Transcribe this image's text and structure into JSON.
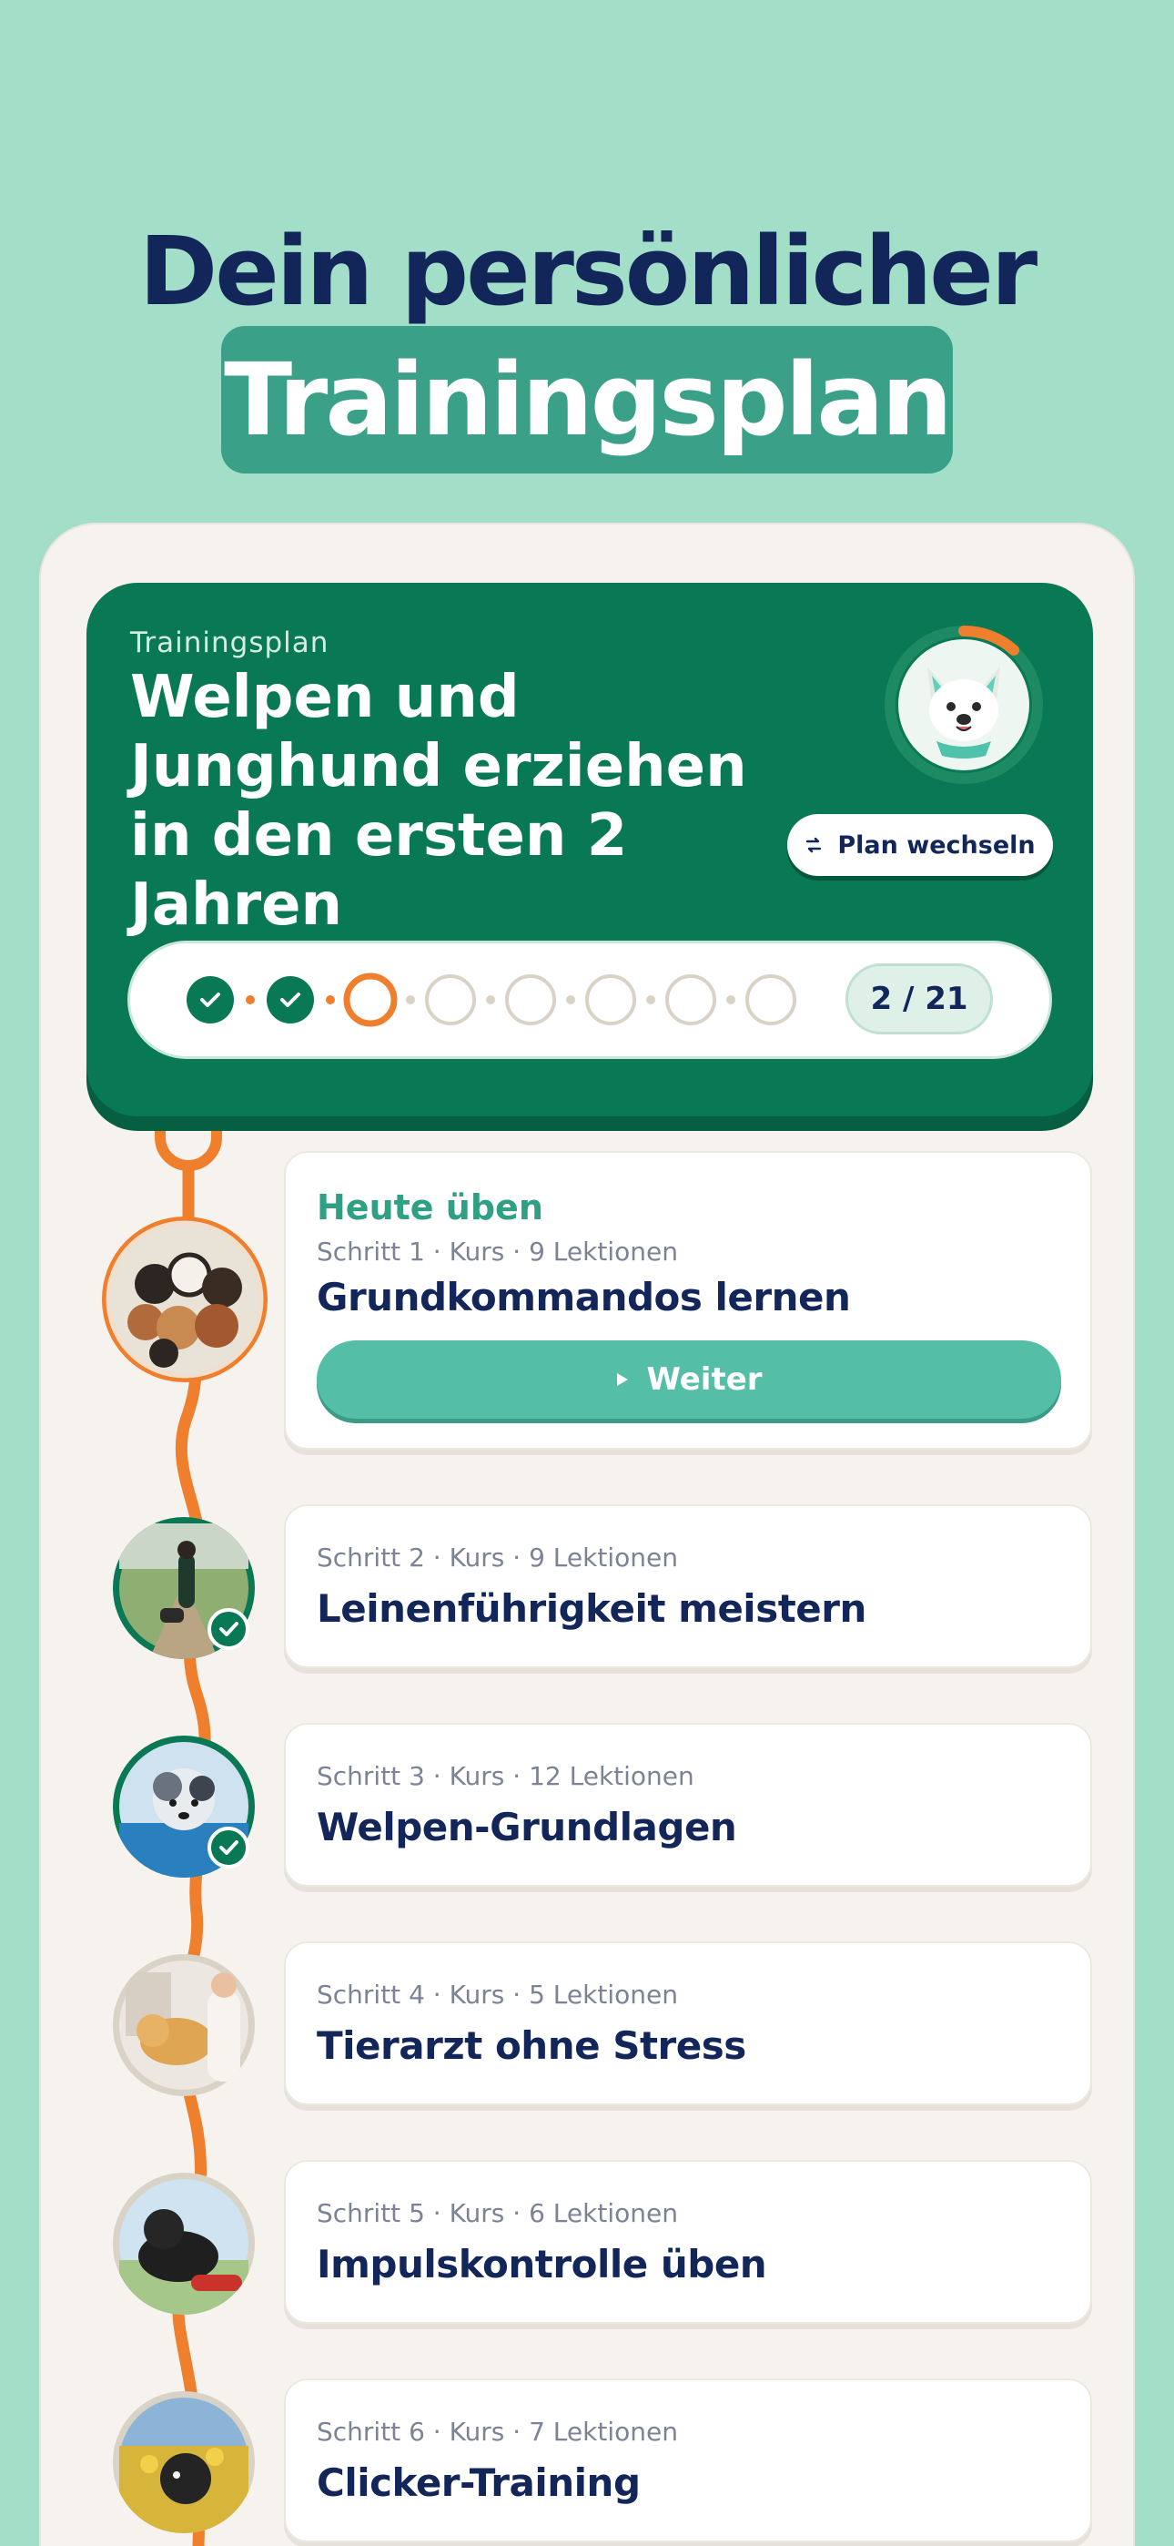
{
  "header": {
    "line1": "Dein persönlicher",
    "line2": "Trainingsplan"
  },
  "plan": {
    "label": "Trainingsplan",
    "title": "Welpen und Junghund erziehen in den ersten 2 Jahren",
    "switch_label": "Plan wechseln",
    "progress_text": "2 / 21",
    "completed": 2,
    "current": 3,
    "visible_steps": 8,
    "avatar_progress": 0.1
  },
  "courses": [
    {
      "today": "Heute üben",
      "meta": "Schritt 1 · Kurs · 9 Lektionen",
      "title": "Grundkommandos lernen",
      "button": "Weiter",
      "done": false
    },
    {
      "meta": "Schritt 2 · Kurs · 9 Lektionen",
      "title": "Leinenführigkeit meistern",
      "done": true
    },
    {
      "meta": "Schritt 3 · Kurs · 12 Lektionen",
      "title": "Welpen-Grundlagen",
      "done": true
    },
    {
      "meta": "Schritt 4 · Kurs · 5 Lektionen",
      "title": "Tierarzt ohne Stress",
      "done": false
    },
    {
      "meta": "Schritt 5 · Kurs · 6 Lektionen",
      "title": "Impulskontrolle üben",
      "done": false
    },
    {
      "meta": "Schritt 6 · Kurs · 7 Lektionen",
      "title": "Clicker-Training",
      "done": false
    }
  ],
  "colors": {
    "background": "#a2dec8",
    "plan_card": "#087954",
    "accent_orange": "#e8772e",
    "button_teal": "#54bea7",
    "navy_text": "#13265a"
  },
  "icons": [
    "check-icon",
    "swap-icon",
    "play-icon",
    "dog-mascot-icon"
  ]
}
